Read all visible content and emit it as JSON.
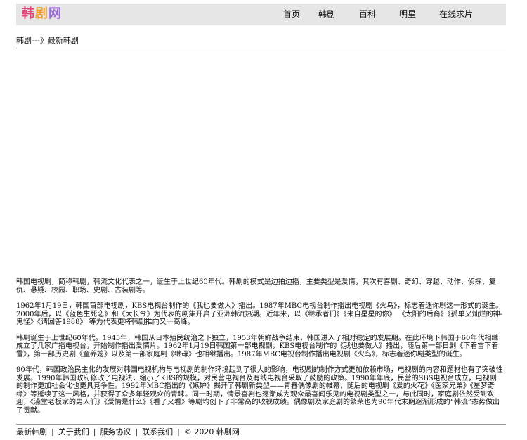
{
  "logo": {
    "char1": "韩",
    "char2": "剧",
    "char3": "网"
  },
  "nav": {
    "items": [
      "首页",
      "韩剧",
      "百科",
      "明星",
      "在线求片"
    ]
  },
  "breadcrumb": {
    "home": "韩剧",
    "separator": "---》",
    "current": "最新韩剧"
  },
  "article": {
    "paragraphs": [
      "韩国电视剧，简称韩剧，韩流文化代表之一，诞生于上世纪60年代。韩剧的模式是边拍边播，主要类型是爱情，其次有喜剧、奇幻、穿越、动作、侦探、复仇、悬疑、校园、职场、史剧、古装剧等。",
      "1962年1月19日，韩国首部电视剧，KBS电视台制作的《我也要做人》播出。1987年MBC电视台制作播出电视剧《火鸟》，标志着迷你剧这一形式的诞生。2000年后，以《蓝色生死恋》和《大长今》为代表的剧集开启了亚洲韩流热潮。近年来，以《继承者们》《来自星星的你》 《太阳的后裔》《孤单又灿烂的神-鬼怪》《请回答1988》 等为代表更将韩剧推向又一高峰。",
      "韩剧诞生于上世纪60年代。1945年，韩国从日本殖民统治之下独立，1953年朝鲜战争结束，韩国进入了相对稳定的发展期。在此环境下韩国于60年代相继成立了几家广播电视台，开始制作播出爱情片。1962年1月19日韩国第一部电视剧，KBS电视台制作的《我也要做人》播出，随后第一部日剧《下着雪下着雪》，第一部历史剧《童养媳》以及第一部家庭剧《继母》也相继播出。1987年MBC电视台制作播出电视剧《火鸟》，标志着迷你剧类型的诞生。",
      "90年代，韩国政治民主化的发展对韩国电视机构与电视剧的制作环境起到了很大的影响，电视剧的制作方式更加依赖市场，电视剧的内容和题材也有了突破性发展。1990年韩国政府修改了电视法，缩小了KBS的规模，对民营电视台及有线电视台采取了鼓励的政策。1990年年底，民营的SBS电视台成立，电视剧的制作更加社会化也更具竞争性。1992年MBC播出的《嫉妒》揭开了韩剧新类型——青春偶像剧的帷幕，随后的电视剧《爱的火花》《医家兄弟》《星梦奇缘》等延续了这一风格，并获得了众多年轻观众的青睐。同一时期，情景喜剧也逐渐成为观众最喜闻乐见的电视剧类型之一，与此同时，家庭剧依然受到欢迎，《澡堂老板家的男人们》《爱情是什么》《看了又看》等剧均创下了非常高的收视成绩。偶像剧及家庭剧的繁荣也为90年代末期逐渐形成的“韩流”态势做出了贡献。"
    ]
  },
  "footer": {
    "links": [
      "最新韩剧",
      "关于我们",
      "服务协议",
      "联系我们"
    ],
    "separator": "|",
    "copyright": "© 2020 韩剧网"
  }
}
